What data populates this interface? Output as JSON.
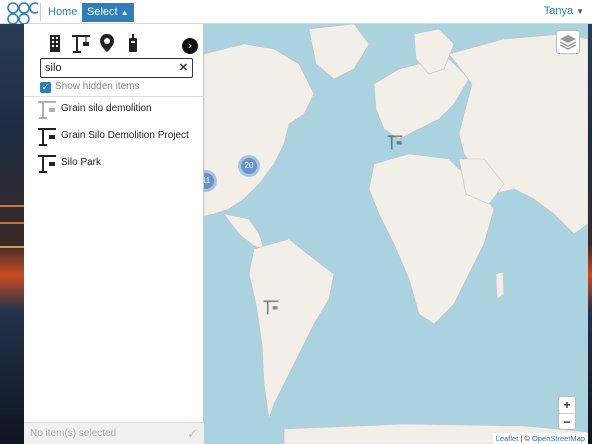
{
  "nav": {
    "home_label": "Home",
    "select_label": "Select",
    "select_caret": "▲",
    "user_name": "Tanya",
    "user_caret": "▼",
    "accent": "#2c7fb8"
  },
  "panel": {
    "type_icons": [
      "building-icon",
      "crane-icon",
      "map-pin-icon",
      "tower-icon"
    ],
    "next_glyph": "›",
    "search": {
      "value": "silo",
      "clear_glyph": "✕"
    },
    "show_hidden": {
      "label": "Show hidden items",
      "checked": true,
      "check_glyph": "✓"
    },
    "results": [
      {
        "label": "Grain silo demolition",
        "icon": "crane-icon-faded"
      },
      {
        "label": "Grain Silo Demolition Project",
        "icon": "crane-icon"
      },
      {
        "label": "Silo Park",
        "icon": "crane-icon"
      }
    ],
    "footer": {
      "status": "No item(s) selected",
      "confirm_glyph": "✓"
    }
  },
  "map": {
    "clusters": [
      {
        "count": "20"
      },
      {
        "count": "11"
      }
    ],
    "zoom_in": "+",
    "zoom_out": "−",
    "attribution_leaflet": "Leaflet",
    "attribution_sep": " | © ",
    "attribution_osm": "OpenStreetMap",
    "land_color": "#f2efe9",
    "water_color": "#aad3df"
  }
}
